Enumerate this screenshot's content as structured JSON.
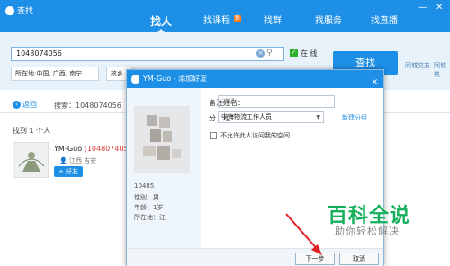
{
  "app": {
    "title": "查找",
    "minimize": "—",
    "close": "✕"
  },
  "tabs": [
    {
      "label": "找人",
      "active": true
    },
    {
      "label": "找课程",
      "badge": "新"
    },
    {
      "label": "找群"
    },
    {
      "label": "找服务"
    },
    {
      "label": "找直播"
    }
  ],
  "search": {
    "value": "1048074056",
    "online_label": "在 线",
    "online_checked": true,
    "find_button": "查找",
    "location": "所在地:中国, 广西, 南宁",
    "hometown": "故乡",
    "side_links": [
      "同城交友",
      "同城热"
    ]
  },
  "nav": {
    "back": "返回",
    "crumb": "搜索：1048074056"
  },
  "results": {
    "found": "找到 1 个人",
    "name": "YM-Guo",
    "number": "(1048074056)",
    "location": "江西 吉安",
    "add_button": "+ 好友"
  },
  "dialog": {
    "title": "YM-Guo - 添加好友",
    "close": "✕",
    "account_partial": "10485",
    "gender": "性别：男",
    "age": "年龄：1岁",
    "location": "所在地：江",
    "remark_label": "备注姓名：",
    "remark_placeholder": "选填",
    "group_label": "分　组：",
    "group_value": "中海物流工作人员",
    "new_group": "新建分组",
    "deny_label": "不允许此人访问我的空间",
    "next_button": "下一步",
    "cancel_button": "取消"
  },
  "watermark": {
    "title": "百科全说",
    "subtitle": "助你轻松解决"
  }
}
